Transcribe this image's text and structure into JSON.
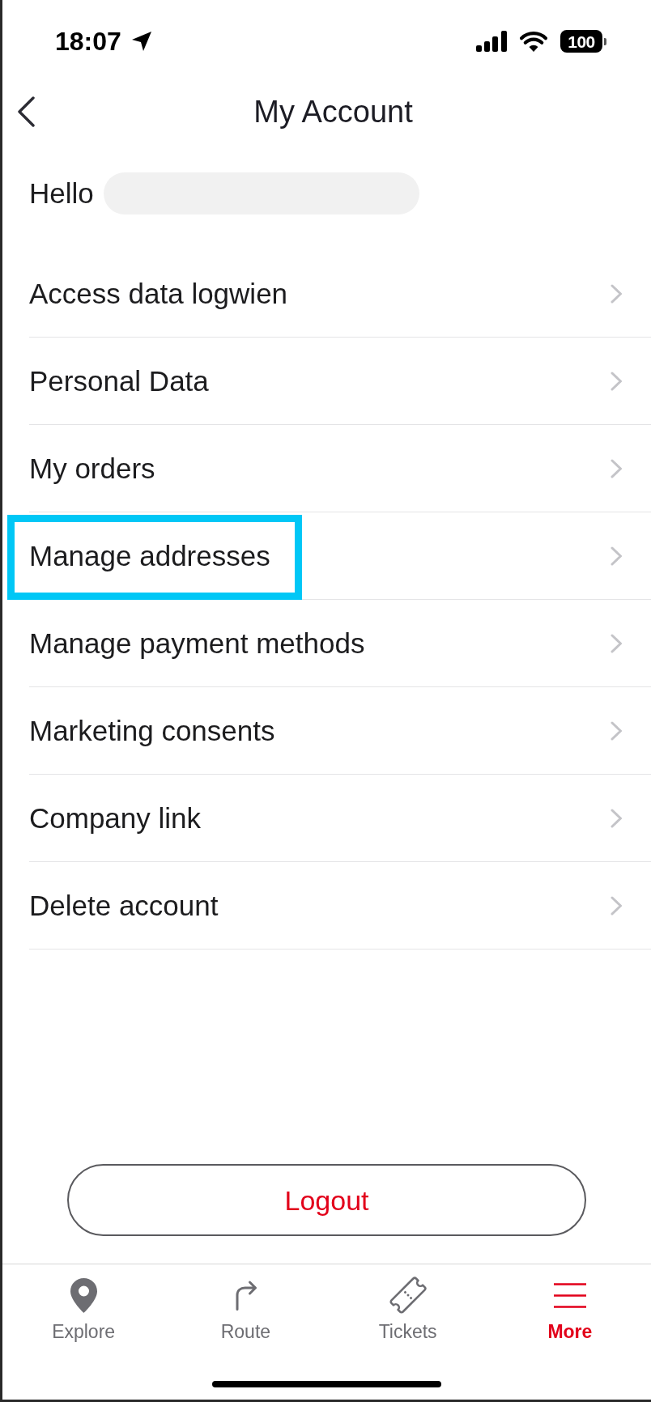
{
  "status_bar": {
    "time": "18:07",
    "battery": "100"
  },
  "header": {
    "title": "My Account"
  },
  "greeting": {
    "text": "Hello"
  },
  "menu_items": [
    {
      "label": "Access data logwien",
      "highlighted": false
    },
    {
      "label": "Personal Data",
      "highlighted": false
    },
    {
      "label": "My orders",
      "highlighted": false
    },
    {
      "label": "Manage addresses",
      "highlighted": true
    },
    {
      "label": "Manage payment methods",
      "highlighted": false
    },
    {
      "label": "Marketing consents",
      "highlighted": false
    },
    {
      "label": "Company link",
      "highlighted": false
    },
    {
      "label": "Delete account",
      "highlighted": false
    }
  ],
  "logout_button": {
    "label": "Logout"
  },
  "tab_bar": [
    {
      "label": "Explore",
      "selected": false
    },
    {
      "label": "Route",
      "selected": false
    },
    {
      "label": "Tickets",
      "selected": false
    },
    {
      "label": "More",
      "selected": true
    }
  ]
}
